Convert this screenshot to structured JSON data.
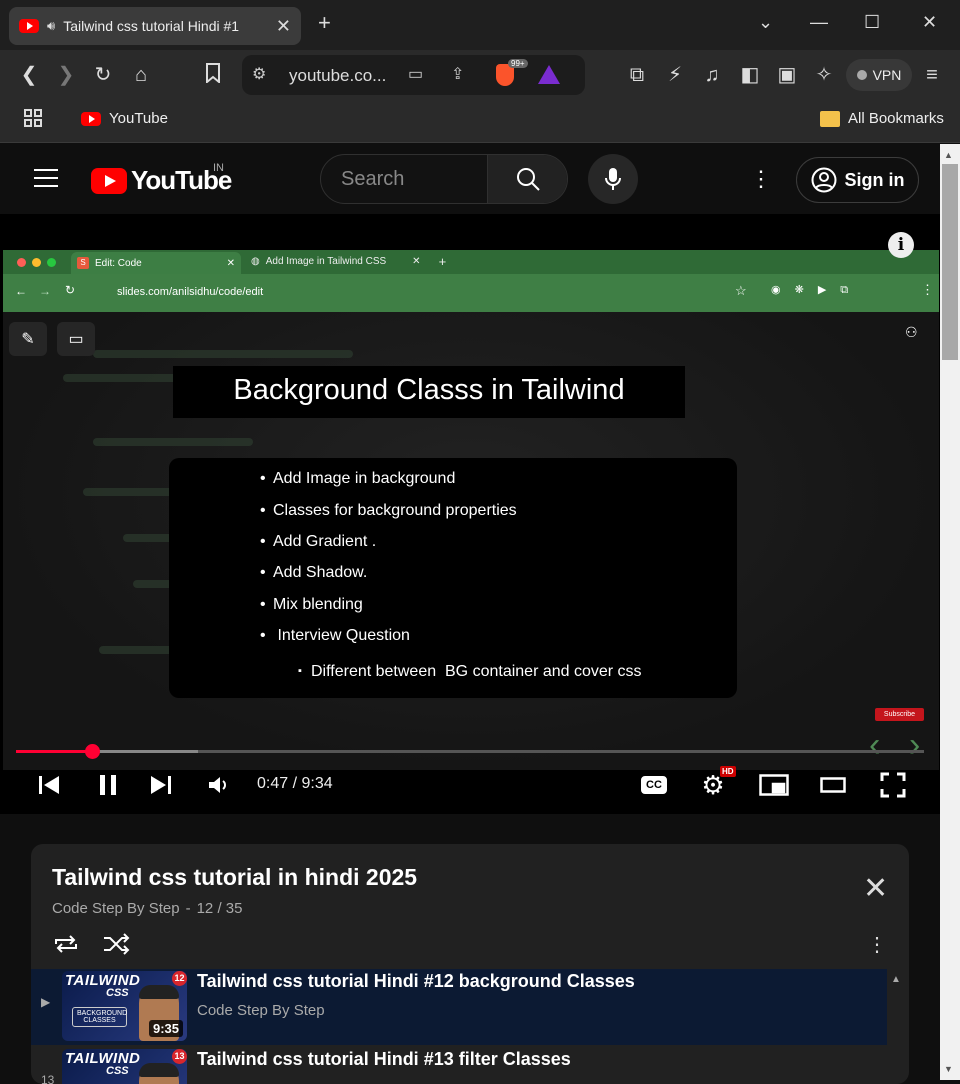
{
  "browser": {
    "tab_title": "Tailwind css tutorial Hindi #1",
    "tab_close": "✕",
    "url": "youtube.co...",
    "brave_badge": "99+",
    "vpn_label": "VPN",
    "bookmarks": [
      {
        "label": "YouTube"
      }
    ],
    "all_bookmarks_label": "All Bookmarks"
  },
  "youtube": {
    "logo_text": "YouTube",
    "country_code": "IN",
    "search_placeholder": "Search",
    "sign_in_label": "Sign in"
  },
  "video": {
    "inner_tabs": [
      "Edit: Code",
      "Add Image in Tailwind CSS"
    ],
    "inner_url": "slides.com/anilsidhu/code/edit",
    "slide_title": "Background Classs in Tailwind",
    "slide_bullets": [
      "Add Image in background",
      "Classes for background properties",
      "Add Gradient .",
      "Add Shadow.",
      "Mix blending",
      " Interview Question"
    ],
    "slide_sub_bullet": "Different between  BG container and cover css",
    "subscribe_mini": "Subscribe",
    "time_display": "0:47 / 9:34",
    "progress_fraction": 0.0837,
    "buffer_fraction": 0.2,
    "hd_badge": "HD",
    "cc_label": "CC"
  },
  "playlist": {
    "title": "Tailwind css tutorial in hindi 2025",
    "channel": "Code Step By Step",
    "separator": "-",
    "position": "12 / 35",
    "items": [
      {
        "index": "▶",
        "title": "Tailwind css tutorial Hindi #12 background Classes",
        "channel": "Code Step By Step",
        "duration": "9:35",
        "thumb_text": "TAILWIND",
        "thumb_sub": "CSS",
        "thumb_num": "12",
        "thumb_tag": "BACKGROUND CLASSES"
      },
      {
        "index": "13",
        "title": "Tailwind css tutorial Hindi #13 filter Classes",
        "channel": "",
        "duration": "",
        "thumb_text": "TAILWIND",
        "thumb_sub": "CSS",
        "thumb_num": "13",
        "thumb_tag": ""
      }
    ]
  },
  "colors": {
    "accent_red": "#ff0033",
    "youtube_red": "#ff0000",
    "active_row": "#0c1a33"
  }
}
